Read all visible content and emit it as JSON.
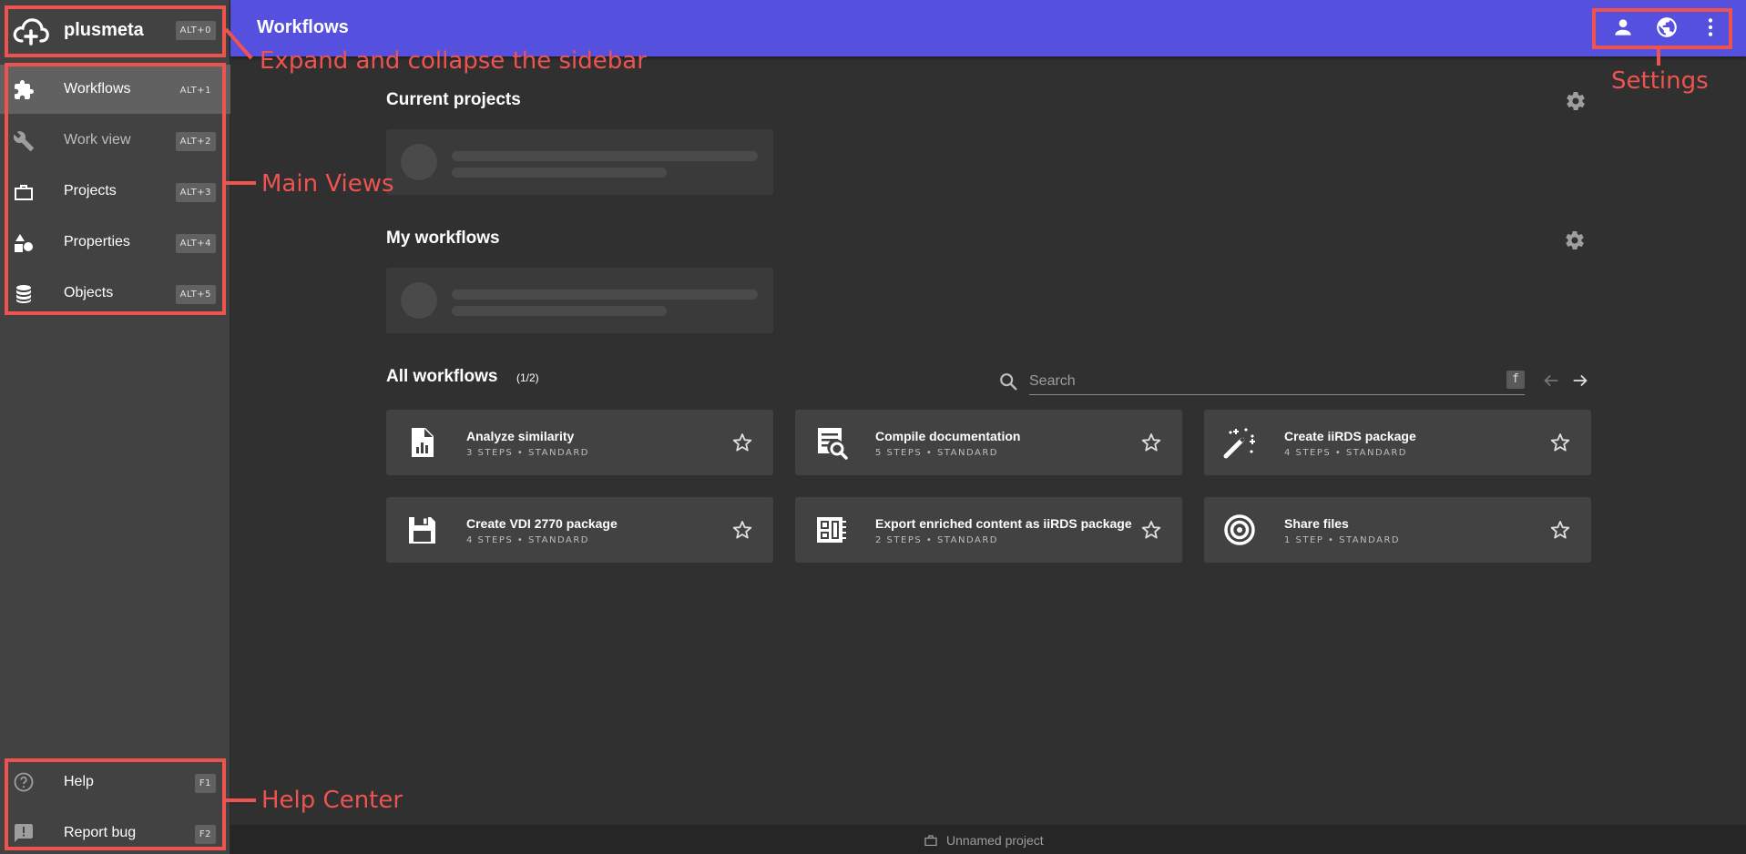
{
  "app": {
    "name": "plusmeta",
    "shortcut": "ALT+0"
  },
  "sidebar": {
    "items": [
      {
        "label": "Workflows",
        "shortcut": "ALT+1",
        "icon": "puzzle-icon"
      },
      {
        "label": "Work view",
        "shortcut": "ALT+2",
        "icon": "wrench-icon"
      },
      {
        "label": "Projects",
        "shortcut": "ALT+3",
        "icon": "briefcase-icon"
      },
      {
        "label": "Properties",
        "shortcut": "ALT+4",
        "icon": "shapes-icon"
      },
      {
        "label": "Objects",
        "shortcut": "ALT+5",
        "icon": "database-icon"
      }
    ],
    "help": [
      {
        "label": "Help",
        "shortcut": "F1",
        "icon": "help-circle-icon"
      },
      {
        "label": "Report bug",
        "shortcut": "F2",
        "icon": "feedback-icon"
      }
    ]
  },
  "topbar": {
    "title": "Workflows",
    "actions": [
      "account-icon",
      "language-icon",
      "more-vert-icon"
    ]
  },
  "main": {
    "current_projects": {
      "title": "Current projects"
    },
    "my_workflows": {
      "title": "My workflows"
    },
    "all_workflows": {
      "title": "All workflows",
      "page": "(1/2)",
      "search_placeholder": "Search",
      "search_shortcut": "f",
      "cards": [
        {
          "title": "Analyze similarity",
          "subtitle": "3 STEPS • STANDARD",
          "icon": "chart-doc-icon"
        },
        {
          "title": "Compile documentation",
          "subtitle": "5 STEPS • STANDARD",
          "icon": "doc-search-icon"
        },
        {
          "title": "Create iiRDS package",
          "subtitle": "4 STEPS • STANDARD",
          "icon": "magic-wand-icon"
        },
        {
          "title": "Create VDI 2770 package",
          "subtitle": "4 STEPS • STANDARD",
          "icon": "save-icon"
        },
        {
          "title": "Export enriched content as iiRDS package",
          "subtitle": "2 STEPS • STANDARD",
          "icon": "dashboard-icon"
        },
        {
          "title": "Share files",
          "subtitle": "1 STEP • STANDARD",
          "icon": "target-icon"
        }
      ]
    }
  },
  "footer": {
    "project": "Unnamed project"
  },
  "annotations": {
    "sidebar_toggle": "Expand and collapse the sidebar",
    "main_views": "Main Views",
    "settings": "Settings",
    "help_center": "Help Center",
    "color": "#ef5350"
  },
  "colors": {
    "accent": "#5550dd",
    "sidebar": "#424242",
    "background": "#303030",
    "card": "#424242"
  }
}
